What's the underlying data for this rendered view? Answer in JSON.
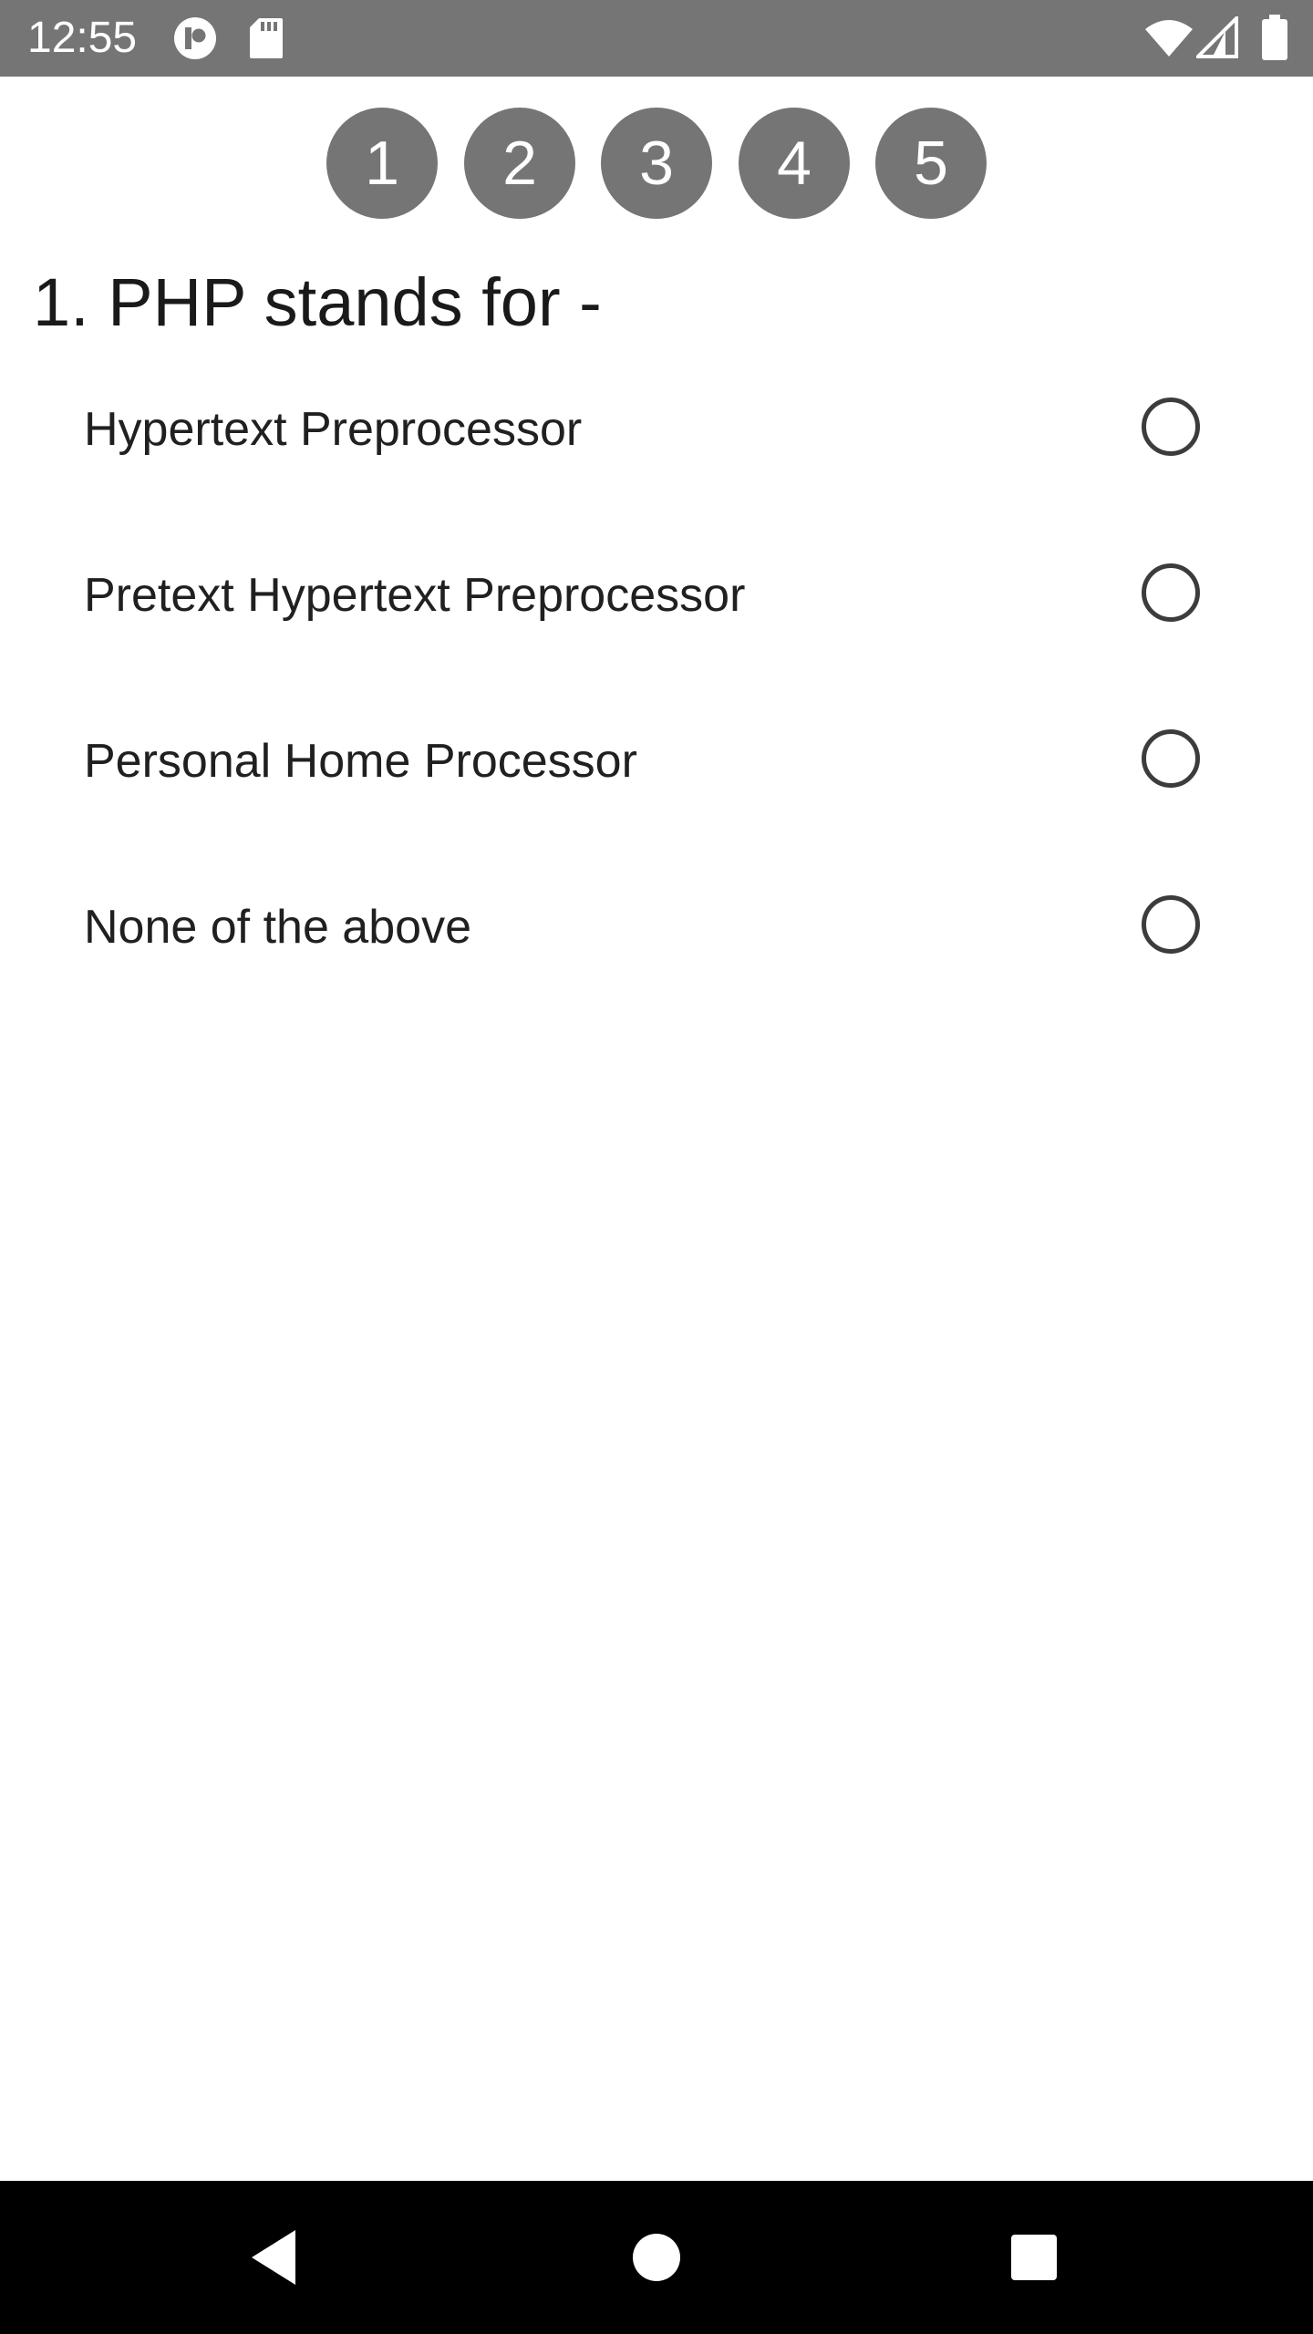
{
  "status_bar": {
    "time": "12:55",
    "left_icons": [
      "app-notification-icon",
      "sd-card-icon"
    ],
    "right_icons": [
      "wifi-icon",
      "cell-signal-icon",
      "battery-icon"
    ],
    "background_color": "#757575"
  },
  "steps": [
    "1",
    "2",
    "3",
    "4",
    "5"
  ],
  "question": {
    "title": "1. PHP stands for -",
    "options": [
      {
        "label": "Hypertext Preprocessor",
        "selected": false
      },
      {
        "label": "Pretext Hypertext Preprocessor",
        "selected": false
      },
      {
        "label": "Personal Home Processor",
        "selected": false
      },
      {
        "label": "None of the above",
        "selected": false
      }
    ]
  },
  "nav_bar": {
    "buttons": [
      "back-icon",
      "home-icon",
      "recents-icon"
    ]
  }
}
